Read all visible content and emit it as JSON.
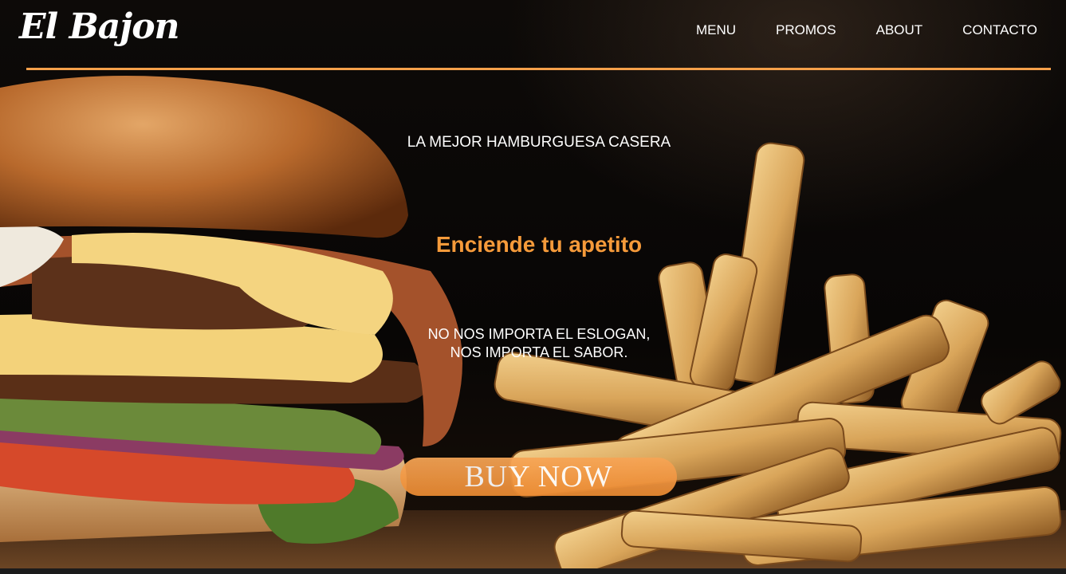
{
  "brand": {
    "logo_text": "El Bajon"
  },
  "nav": {
    "items": [
      {
        "label": "MENU"
      },
      {
        "label": "PROMOS"
      },
      {
        "label": "ABOUT"
      },
      {
        "label": "CONTACTO"
      }
    ]
  },
  "hero": {
    "tagline": "LA MEJOR HAMBURGUESA CASERA",
    "headline": "Enciende tu apetito",
    "slogan_line1": "NO NOS IMPORTA EL ESLOGAN,",
    "slogan_line2": "NOS IMPORTA EL SABOR.",
    "cta_label": "BUY NOW"
  },
  "colors": {
    "accent": "#f59a3a",
    "rule": "#f5a04a",
    "text": "#ffffff",
    "background": "#0b0806"
  },
  "icons": [
    "burger-photo",
    "fries-photo"
  ]
}
